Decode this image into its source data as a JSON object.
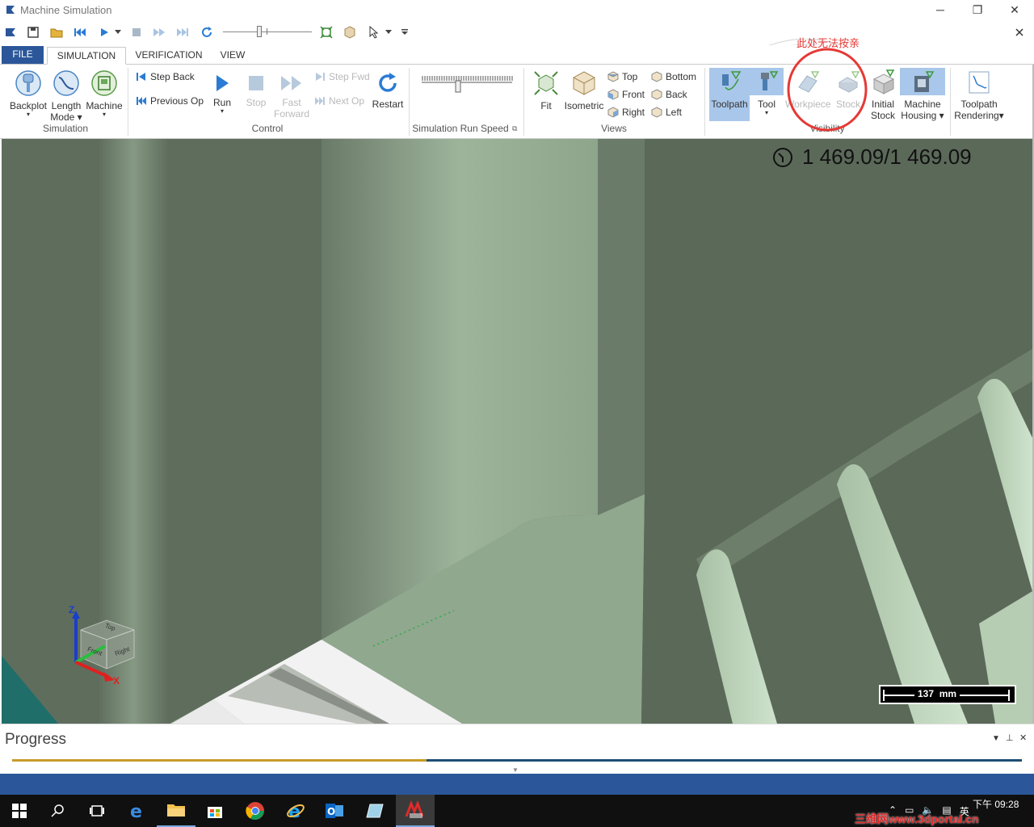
{
  "window": {
    "title": "Machine Simulation"
  },
  "tabs": [
    {
      "label": "FILE"
    },
    {
      "label": "SIMULATION"
    },
    {
      "label": "VERIFICATION"
    },
    {
      "label": "VIEW"
    }
  ],
  "ribbon": {
    "simulation_group": {
      "label": "Simulation",
      "backplot": "Backplot",
      "length_mode_1": "Length",
      "length_mode_2": "Mode",
      "machine": "Machine"
    },
    "control_group": {
      "label": "Control",
      "step_back": "Step Back",
      "previous_op": "Previous Op",
      "run": "Run",
      "stop": "Stop",
      "fast_forward_1": "Fast",
      "fast_forward_2": "Forward",
      "step_fwd": "Step Fwd",
      "next_op": "Next Op",
      "restart": "Restart"
    },
    "speed_group": {
      "label": "Simulation Run Speed"
    },
    "views_group": {
      "label": "Views",
      "fit": "Fit",
      "isometric": "Isometric",
      "top": "Top",
      "front": "Front",
      "right": "Right",
      "bottom": "Bottom",
      "back": "Back",
      "left": "Left"
    },
    "visibility_group": {
      "label": "Visibility",
      "toolpath": "Toolpath",
      "tool": "Tool",
      "workpiece": "Workpiece",
      "stock": "Stock",
      "initial_stock_1": "Initial",
      "initial_stock_2": "Stock",
      "machine_housing_1": "Machine",
      "machine_housing_2": "Housing",
      "toolpath_rendering_1": "Toolpath",
      "toolpath_rendering_2": "Rendering"
    }
  },
  "annotation": {
    "text": "此处无法按亲",
    "color": "#e53935"
  },
  "viewport": {
    "time_readout": "1 469.09/1 469.09",
    "scale_bar": "137  mm",
    "axis_z": "Z",
    "axis_x": "X",
    "cube_top": "Top",
    "cube_front": "Front",
    "cube_right": "Right"
  },
  "progress": {
    "title": "Progress",
    "fraction": 0.41
  },
  "taskbar": {
    "clock": "下午 09:28",
    "ime": "英",
    "watermark": "三维网www.3dportal.cn"
  },
  "colors": {
    "accent": "#2b579a",
    "highlight": "#a9c7ea",
    "model_light": "#9db49b",
    "model_dark": "#5f6d5d"
  }
}
